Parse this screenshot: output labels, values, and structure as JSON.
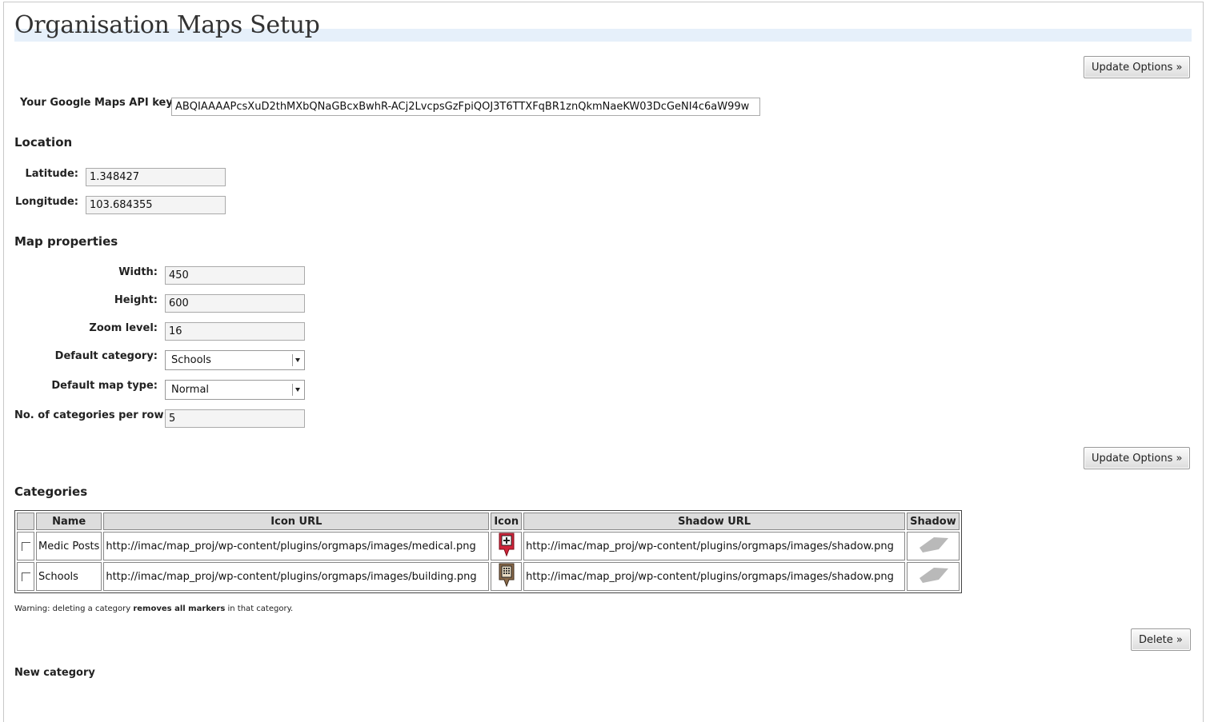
{
  "page": {
    "title": "Organisation Maps Setup"
  },
  "buttons": {
    "update_options": "Update Options »",
    "delete": "Delete »"
  },
  "api": {
    "label": "Your Google Maps API key:",
    "value": "ABQIAAAAPcsXuD2thMXbQNaGBcxBwhR-ACj2LvcpsGzFpiQOJ3T6TTXFqBR1znQkmNaeKW03DcGeNI4c6aW99w"
  },
  "location": {
    "heading": "Location",
    "latitude_label": "Latitude:",
    "latitude": "1.348427",
    "longitude_label": "Longitude:",
    "longitude": "103.684355"
  },
  "map_properties": {
    "heading": "Map properties",
    "width_label": "Width:",
    "width": "450",
    "height_label": "Height:",
    "height": "600",
    "zoom_label": "Zoom level:",
    "zoom": "16",
    "default_category_label": "Default category:",
    "default_category": "Schools",
    "default_map_type_label": "Default map type:",
    "default_map_type": "Normal",
    "per_row_label": "No. of categories per row:",
    "per_row": "5"
  },
  "categories": {
    "heading": "Categories",
    "columns": [
      "Name",
      "Icon URL",
      "Icon",
      "Shadow URL",
      "Shadow"
    ],
    "rows": [
      {
        "name": "Medic Posts",
        "icon_url": "http://imac/map_proj/wp-content/plugins/orgmaps/images/medical.png",
        "icon": "medical-marker-icon",
        "shadow_url": "http://imac/map_proj/wp-content/plugins/orgmaps/images/shadow.png",
        "shadow": "marker-shadow-icon"
      },
      {
        "name": "Schools",
        "icon_url": "http://imac/map_proj/wp-content/plugins/orgmaps/images/building.png",
        "icon": "building-marker-icon",
        "shadow_url": "http://imac/map_proj/wp-content/plugins/orgmaps/images/shadow.png",
        "shadow": "marker-shadow-icon"
      }
    ],
    "warning_pre": "Warning: deleting a category ",
    "warning_bold": "removes all markers",
    "warning_post": " in that category."
  },
  "new_category": {
    "heading": "New category"
  },
  "colors": {
    "title_bar": "#e6f0fa",
    "medical_marker": "#d0243a",
    "building_marker": "#8a6a4a"
  }
}
